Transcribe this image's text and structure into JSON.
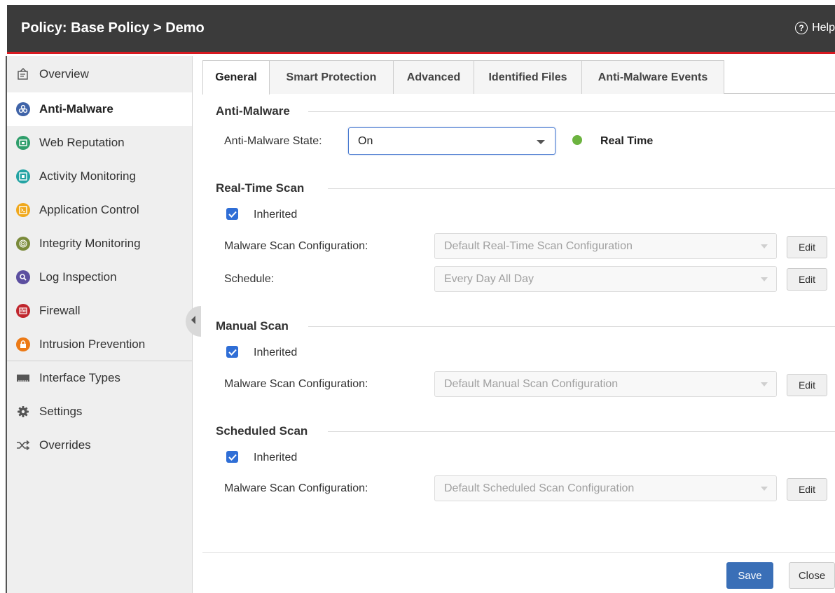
{
  "header": {
    "title": "Policy: Base Policy > Demo",
    "help_label": "Help",
    "accent_color": "#d71920"
  },
  "sidebar": {
    "items": [
      {
        "label": "Overview",
        "icon": "overview-icon"
      },
      {
        "label": "Anti-Malware",
        "icon": "biohazard-icon",
        "active": true
      },
      {
        "label": "Web Reputation",
        "icon": "web-reputation-icon"
      },
      {
        "label": "Activity Monitoring",
        "icon": "activity-monitoring-icon"
      },
      {
        "label": "Application Control",
        "icon": "application-control-icon"
      },
      {
        "label": "Integrity Monitoring",
        "icon": "fingerprint-icon"
      },
      {
        "label": "Log Inspection",
        "icon": "magnifier-icon"
      },
      {
        "label": "Firewall",
        "icon": "firewall-icon"
      },
      {
        "label": "Intrusion Prevention",
        "icon": "intrusion-prevention-icon"
      },
      {
        "label": "Interface Types",
        "icon": "network-interface-icon"
      },
      {
        "label": "Settings",
        "icon": "gear-icon"
      },
      {
        "label": "Overrides",
        "icon": "shuffle-icon"
      }
    ]
  },
  "tabs": [
    {
      "label": "General",
      "active": true
    },
    {
      "label": "Smart Protection"
    },
    {
      "label": "Advanced"
    },
    {
      "label": "Identified Files"
    },
    {
      "label": "Anti-Malware Events"
    }
  ],
  "anti_malware": {
    "title": "Anti-Malware",
    "state_label": "Anti-Malware State:",
    "state_value": "On",
    "status_text": "Real Time",
    "status_color": "#6cb33f"
  },
  "real_time_scan": {
    "title": "Real-Time Scan",
    "inherited_label": "Inherited",
    "inherited_checked": true,
    "config_label": "Malware Scan Configuration:",
    "config_value": "Default Real-Time Scan Configuration",
    "schedule_label": "Schedule:",
    "schedule_value": "Every Day All Day",
    "edit_label": "Edit"
  },
  "manual_scan": {
    "title": "Manual Scan",
    "inherited_label": "Inherited",
    "inherited_checked": true,
    "config_label": "Malware Scan Configuration:",
    "config_value": "Default Manual Scan Configuration",
    "edit_label": "Edit"
  },
  "scheduled_scan": {
    "title": "Scheduled Scan",
    "inherited_label": "Inherited",
    "inherited_checked": true,
    "config_label": "Malware Scan Configuration:",
    "config_value": "Default Scheduled Scan Configuration",
    "edit_label": "Edit"
  },
  "footer": {
    "save_label": "Save",
    "close_label": "Close",
    "save_color": "#3a6fb7"
  }
}
